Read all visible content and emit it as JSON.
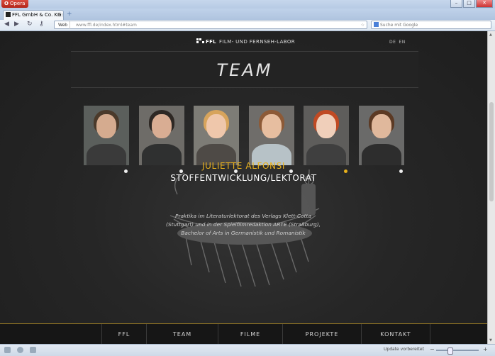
{
  "browser": {
    "app_button_label": "Opera",
    "tab_title": "FFL GmbH & Co. KG: F...",
    "web_label": "Web",
    "url": "www.ffl.de/index.html#team",
    "search_placeholder": "Suche mit Google",
    "status_text": "Update vorbereitet"
  },
  "site": {
    "logo_text": "FFL",
    "logo_subtitle": "FILM- UND FERNSEH-LABOR",
    "languages": [
      "DE",
      "EN"
    ],
    "section_title": "TEAM"
  },
  "team": {
    "active_index": 4,
    "members": [
      {
        "bg": "#5b5f5c",
        "hair": "#4b3a2b",
        "skin": "#d5ab8f",
        "body": "#3a3a3a"
      },
      {
        "bg": "#6e6c68",
        "hair": "#2e2824",
        "skin": "#d9ad93",
        "body": "#2f3030"
      },
      {
        "bg": "#7d7c76",
        "hair": "#d7a45c",
        "skin": "#efc7ab",
        "body": "#4e4a46"
      },
      {
        "bg": "#6f6d6a",
        "hair": "#8d5a37",
        "skin": "#e7bea0",
        "body": "#b7c2c7"
      },
      {
        "bg": "#5e5d5b",
        "hair": "#c04a23",
        "skin": "#f0cfba",
        "body": "#3f3f3f"
      },
      {
        "bg": "#6a6a69",
        "hair": "#5c3a24",
        "skin": "#e0b89c",
        "body": "#2d2d2d"
      }
    ],
    "selected": {
      "name": "JULIETTE ALFONSI",
      "role": "STOFFENTWICKLUNG/LEKTORAT",
      "bio": "Praktika im Literaturlektorat des Verlags Klett-Cotta (Stuttgart) und in der Spielfilmredaktion ARTE (Straßburg), Bachelor of Arts in Germanistik und Romanistik"
    }
  },
  "footer_nav": [
    "FFL",
    "TEAM",
    "FILME",
    "PROJEKTE",
    "KONTAKT"
  ],
  "colors": {
    "accent": "#e8b11b",
    "page_bg": "#262626"
  }
}
